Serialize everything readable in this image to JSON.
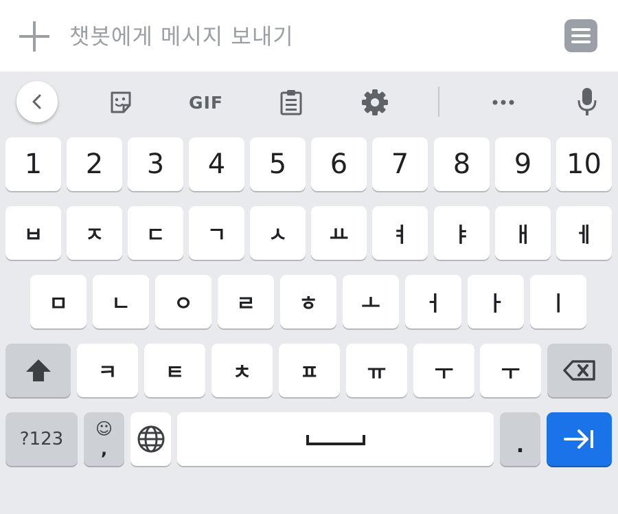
{
  "input_bar": {
    "placeholder": "챗봇에게 메시지 보내기",
    "icons": {
      "left": "plus-icon",
      "right": "menu-lines-icon"
    }
  },
  "toolbar": {
    "gif_label": "GIF",
    "icons": [
      "chevron-left-icon",
      "sticker-icon",
      "gif-icon",
      "clipboard-icon",
      "gear-icon",
      "more-icon",
      "mic-icon"
    ]
  },
  "keyboard": {
    "row_numbers": [
      "1",
      "2",
      "3",
      "4",
      "5",
      "6",
      "7",
      "8",
      "9",
      "10"
    ],
    "row_1": [
      "ㅂ",
      "ㅈ",
      "ㄷ",
      "ㄱ",
      "ㅅ",
      "ㅛ",
      "ㅕ",
      "ㅑ",
      "ㅐ",
      "ㅔ"
    ],
    "row_2": [
      "ㅁ",
      "ㄴ",
      "ㅇ",
      "ㄹ",
      "ㅎ",
      "ㅗ",
      "ㅓ",
      "ㅏ",
      "ㅣ"
    ],
    "row_3": [
      "ㅋ",
      "ㅌ",
      "ㅊ",
      "ㅍ",
      "ㅠ",
      "ㅜ",
      "ㅜ"
    ],
    "bottom": {
      "symbols_label": "?123",
      "emoji_top": "☺",
      "emoji_bottom": ",",
      "period_label": "."
    },
    "colors": {
      "background": "#e8eaed",
      "key": "#ffffff",
      "function_key": "#cdd0d5",
      "enter": "#1a73e8"
    }
  }
}
